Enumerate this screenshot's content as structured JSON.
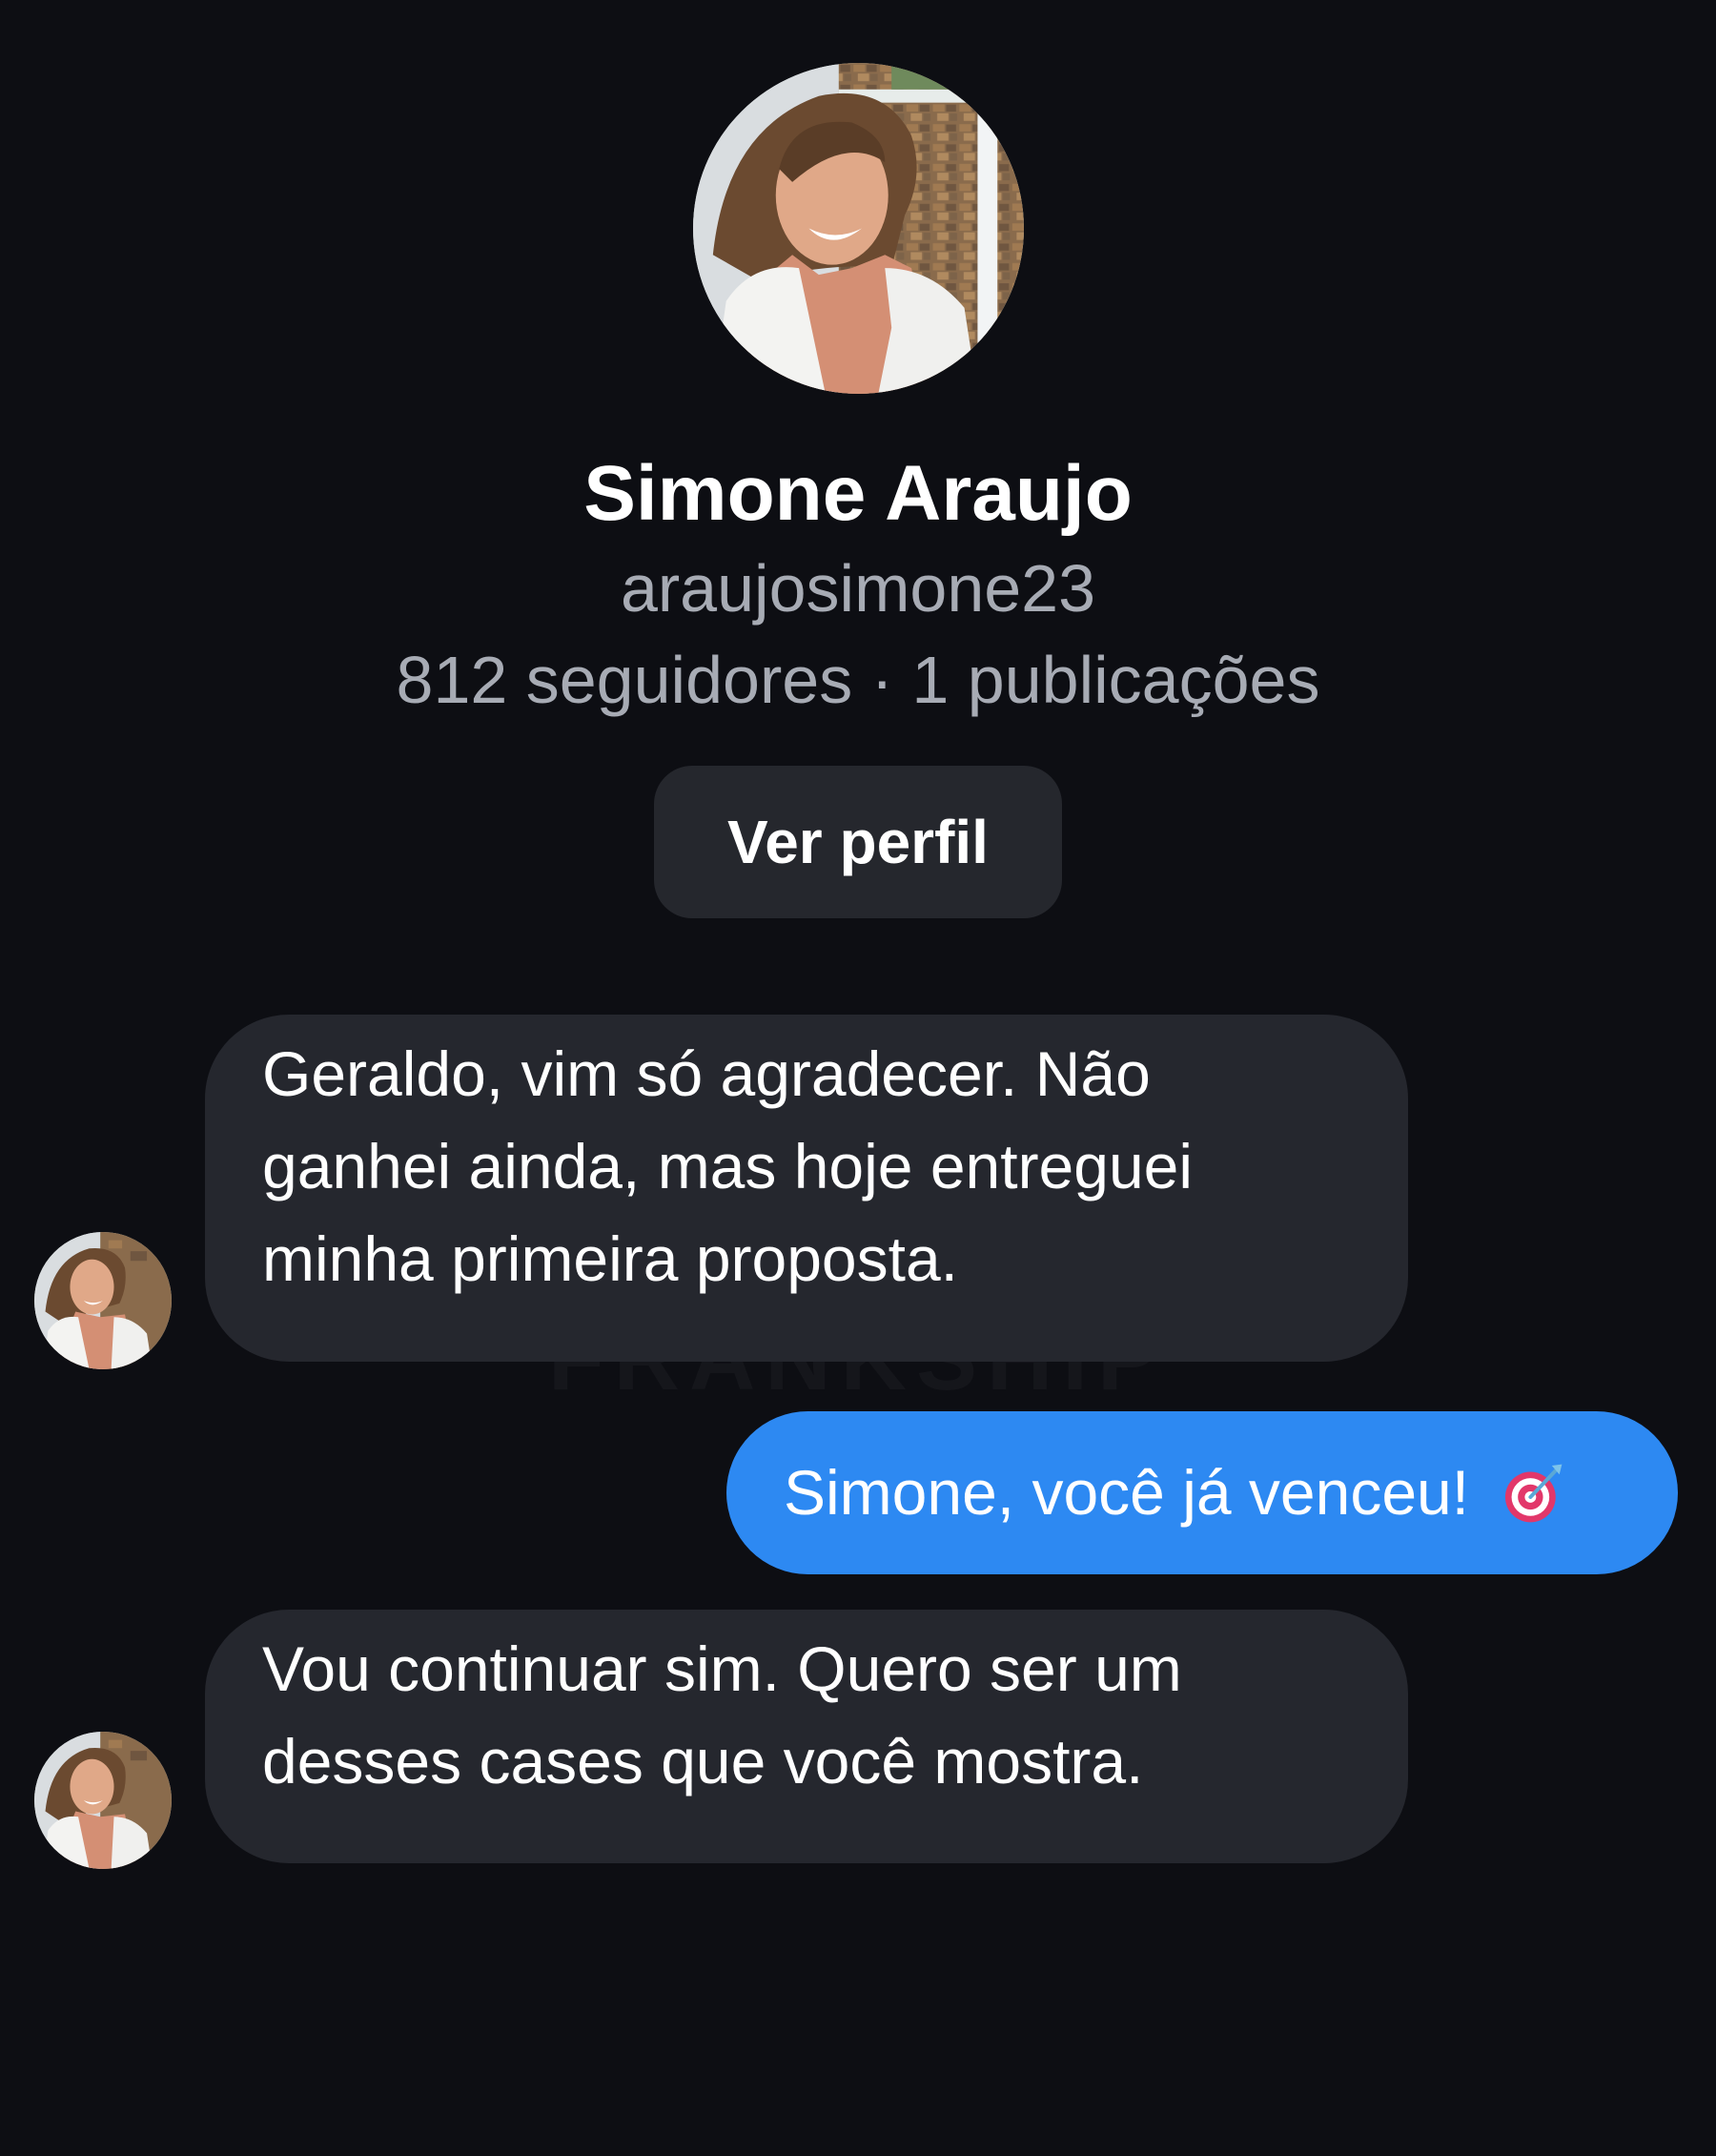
{
  "profile": {
    "name": "Simone Araujo",
    "handle": "araujosimone23",
    "stats": "812 seguidores · 1 publicações",
    "view_profile_label": "Ver perfil"
  },
  "watermark": "FRANKSHIP",
  "messages": [
    {
      "direction": "incoming",
      "lines": [
        "Geraldo, vim só agradecer. Não",
        "ganhei ainda, mas hoje entreguei",
        "minha primeira proposta."
      ]
    },
    {
      "direction": "outgoing",
      "text": "Simone, você já venceu!",
      "emoji": "target-emoji"
    },
    {
      "direction": "incoming",
      "lines": [
        "Vou continuar sim. Quero ser um",
        "desses cases que você mostra."
      ]
    }
  ],
  "colors": {
    "background": "#0d0e13",
    "incoming_bubble": "#25272e",
    "outgoing_bubble": "#2d89f2",
    "secondary_text": "#a7abb4"
  }
}
